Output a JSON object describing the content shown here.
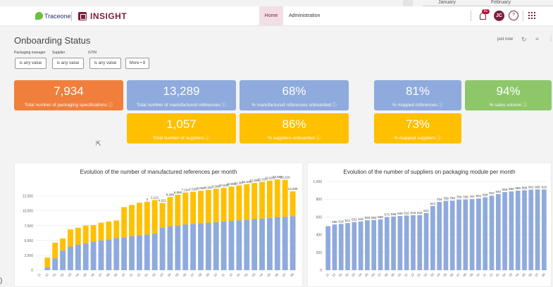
{
  "topbar": {
    "month_1": "January",
    "month_2": "February"
  },
  "header": {
    "logo_text": "Traceone",
    "app_name": "INSIGHT",
    "nav": {
      "home": "Home",
      "admin": "Administration"
    },
    "notifications_badge": "91",
    "avatar_initials": "JC",
    "help_icon": "?"
  },
  "page": {
    "title": "Onboarding Status",
    "refresh_text": "just now"
  },
  "filters": {
    "labels": {
      "packaging_manager": "Packaging manager",
      "supplier": "Supplier",
      "gtin": "GTIN"
    },
    "values": {
      "packaging_manager": "is any value",
      "supplier": "is any value",
      "gtin": "is any value"
    },
    "more": "More • 8"
  },
  "tiles": {
    "packaging_specs": {
      "value": "7,934",
      "label": "Total number of packaging specifications ⓘ",
      "color": "#f07f3c"
    },
    "manufactured_refs": {
      "value": "13,289",
      "label": "Total number of manufactured references ⓘ",
      "color": "#8faadc"
    },
    "pct_manufactured_onboarded": {
      "value": "68%",
      "label": "% manufactured references onboarded ⓘ",
      "color": "#8faadc"
    },
    "mapped_refs": {
      "value": "81%",
      "label": "% mapped references ⓘ",
      "color": "#8faadc"
    },
    "sales_volume": {
      "value": "94%",
      "label": "% sales volume ⓘ",
      "color": "#8dc76a"
    },
    "suppliers": {
      "value": "1,057",
      "label": "Total number of suppliers ⓘ",
      "color": "#ffc000"
    },
    "pct_suppliers_onboarded": {
      "value": "86%",
      "label": "% suppliers onboarded ⓘ",
      "color": "#ffc000"
    },
    "mapped_suppliers": {
      "value": "73%",
      "label": "% mapped suppliers ⓘ",
      "color": "#ffc000"
    }
  },
  "bottom_fragment": ")",
  "chart_data": [
    {
      "type": "bar",
      "title": "Evolution of the number of manufactured references per month",
      "stacked": true,
      "categories": [
        "11",
        "12",
        "01",
        "02",
        "03",
        "04",
        "05",
        "06",
        "07",
        "08",
        "09",
        "10",
        "11",
        "12",
        "01",
        "02",
        "03",
        "04",
        "05",
        "06",
        "07",
        "08",
        "09",
        "10",
        "11",
        "12",
        "01",
        "02",
        "03",
        "04",
        "05",
        "06",
        "07",
        "08"
      ],
      "series": [
        {
          "color": "#8faadc",
          "values": [
            3,
            500,
            2000,
            3300,
            4000,
            4300,
            4500,
            4800,
            5000,
            5200,
            5400,
            5500,
            5700,
            5900,
            6000,
            6200,
            7200,
            7400,
            7500,
            7700,
            7800,
            7900,
            8000,
            8100,
            8200,
            8300,
            8400,
            8500,
            8600,
            8700,
            8800,
            8900,
            9000,
            9100
          ]
        },
        {
          "color": "#ffc000",
          "values": [
            0,
            1621,
            2621,
            2026,
            2869,
            2854,
            3039,
            2799,
            3000,
            2991,
            2980,
            5130,
            5293,
            5467,
            5536,
            5620,
            4117,
            4923,
            5213,
            5385,
            5420,
            5485,
            5535,
            5620,
            5700,
            5800,
            5900,
            6000,
            6100,
            6200,
            6300,
            6400,
            6220,
            4189
          ]
        }
      ],
      "data_labels": [
        "3",
        "2,121",
        "4,621",
        "5,326",
        "6,869",
        "7,154",
        "7,539",
        "8,000",
        "8,191",
        "8,380",
        "10,630",
        "10,993",
        "11,367",
        "11,536",
        "11,820",
        "12,317",
        "12,623",
        "13,085",
        "13,220",
        "13,289"
      ],
      "yticks": [
        "0",
        "2,500",
        "5,000",
        "7,500",
        "10,000",
        "12,500"
      ],
      "ylim": [
        0,
        14000
      ]
    },
    {
      "type": "bar",
      "title": "Evolution of the number of suppliers on packaging module per month",
      "categories": [
        "11",
        "12",
        "01",
        "02",
        "03",
        "04",
        "05",
        "06",
        "07",
        "08",
        "09",
        "10",
        "11",
        "12",
        "01",
        "02",
        "03",
        "04",
        "05",
        "06",
        "07",
        "08",
        "09",
        "10",
        "11",
        "12",
        "01",
        "02",
        "03",
        "04",
        "05",
        "06",
        "07",
        "08"
      ],
      "values": [
        496,
        515,
        521,
        531,
        542,
        549,
        562,
        565,
        573,
        598,
        605,
        610,
        616,
        620,
        621,
        644,
        724,
        769,
        782,
        784,
        796,
        797,
        801,
        808,
        822,
        840,
        859,
        880,
        888,
        896,
        901,
        908,
        910,
        910
      ],
      "data_labels": [
        "496",
        "515",
        "521",
        "531",
        "542",
        "549",
        "562",
        "565",
        "573",
        "598",
        "605",
        "610",
        "616",
        "620",
        "621",
        "644",
        "724",
        "769",
        "782",
        "784",
        "796",
        "797",
        "801",
        "808",
        "822",
        "840",
        "859",
        "880",
        "888",
        "896",
        "901",
        "908",
        "910"
      ],
      "yticks": [
        "0",
        "200",
        "400",
        "600",
        "800",
        "1,000"
      ],
      "ylim": [
        0,
        1000
      ]
    }
  ]
}
